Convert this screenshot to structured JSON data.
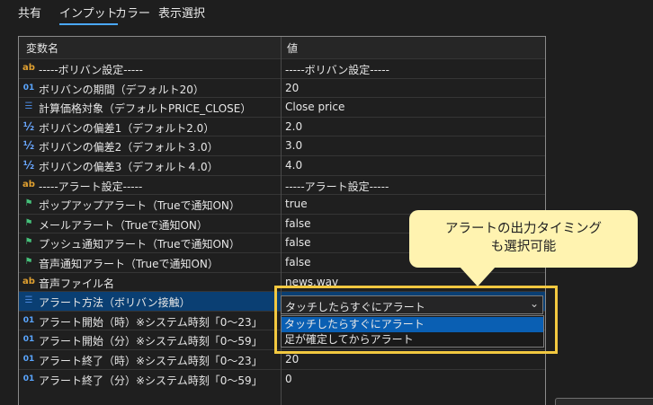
{
  "tabs": [
    {
      "label": "共有"
    },
    {
      "label": "インプット",
      "active": true
    },
    {
      "label": "カラー"
    },
    {
      "label": "表示選択"
    }
  ],
  "grid": {
    "header": {
      "name": "変数名",
      "value": "値"
    },
    "rows": [
      {
        "icon": "ab",
        "name": "-----ボリバン設定-----",
        "value": "-----ボリバン設定-----"
      },
      {
        "icon": "01",
        "name": "ボリバンの期間（デフォルト20）",
        "value": "20"
      },
      {
        "icon": "list",
        "name": "計算価格対象（デフォルトPRICE_CLOSE）",
        "value": "Close price"
      },
      {
        "icon": "½",
        "name": "ボリバンの偏差1（デフォルト2.0）",
        "value": "2.0"
      },
      {
        "icon": "½",
        "name": "ボリバンの偏差2（デフォルト３.0）",
        "value": "3.0"
      },
      {
        "icon": "½",
        "name": "ボリバンの偏差3（デフォルト４.0）",
        "value": "4.0"
      },
      {
        "icon": "ab",
        "name": "-----アラート設定-----",
        "value": "-----アラート設定-----"
      },
      {
        "icon": "flag",
        "name": "ポップアップアラート（Trueで通知ON）",
        "value": "true"
      },
      {
        "icon": "flag",
        "name": "メールアラート（Trueで通知ON）",
        "value": "false"
      },
      {
        "icon": "flag",
        "name": "プッシュ通知アラート（Trueで通知ON）",
        "value": "false"
      },
      {
        "icon": "flag",
        "name": "音声通知アラート（Trueで通知ON）",
        "value": "false"
      },
      {
        "icon": "ab",
        "name": "音声ファイル名",
        "value": "news.wav"
      },
      {
        "icon": "list",
        "name": "アラート方法（ボリバン接触）",
        "value": ""
      },
      {
        "icon": "01",
        "name": "アラート開始（時）※システム時刻「0〜23」",
        "value": ""
      },
      {
        "icon": "01",
        "name": "アラート開始（分）※システム時刻「0〜59」",
        "value": ""
      },
      {
        "icon": "01",
        "name": "アラート終了（時）※システム時刻「0〜23」",
        "value": "20"
      },
      {
        "icon": "01",
        "name": "アラート終了（分）※システム時刻「0〜59」",
        "value": "0"
      }
    ]
  },
  "dropdown": {
    "selected": "タッチしたらすぐにアラート",
    "options": [
      "タッチしたらすぐにアラート",
      "足が確定してからアラート"
    ]
  },
  "callout": {
    "line1": "アラートの出力タイミング",
    "line2": "も選択可能"
  },
  "colors": {
    "accent": "#4aa8ff",
    "highlight_frame": "#f2c840",
    "callout_bg": "#fff3b0",
    "selected_row": "#0a3f73"
  }
}
